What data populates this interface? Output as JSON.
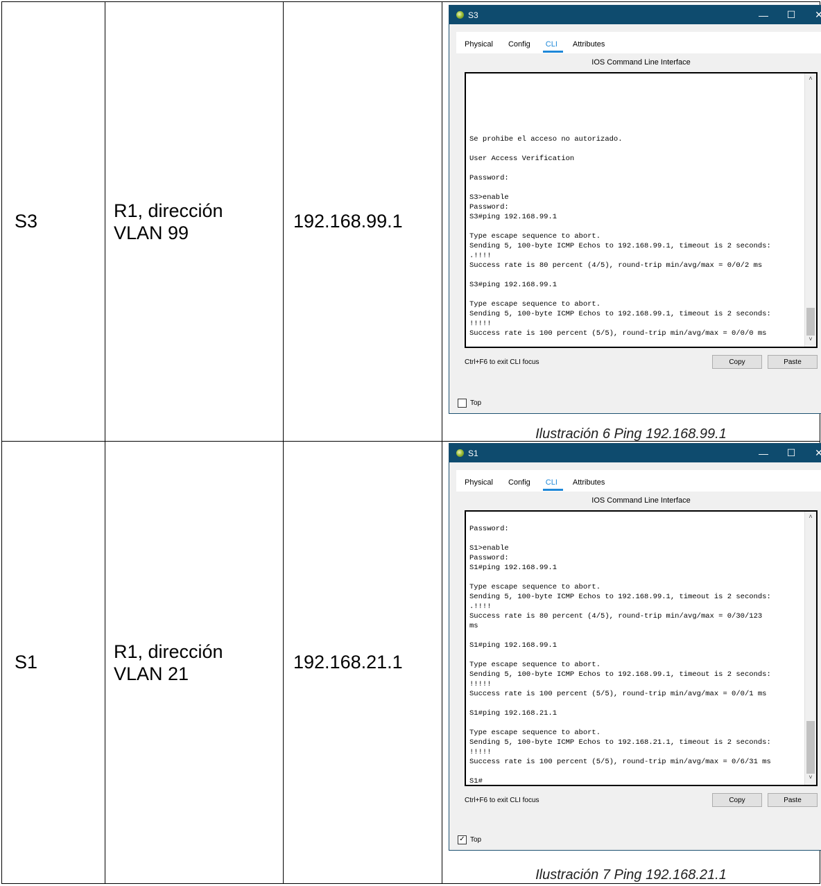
{
  "rows": [
    {
      "device": "S3",
      "description_line1": "R1, dirección",
      "description_line2": "VLAN 99",
      "ip": "192.168.99.1",
      "window": {
        "title": "S3",
        "tabs": [
          "Physical",
          "Config",
          "CLI",
          "Attributes"
        ],
        "active_tab": "CLI",
        "cli_header": "IOS Command Line Interface",
        "terminal_text": "\n\n\n\n\n\nSe prohibe el acceso no autorizado.\n\nUser Access Verification\n\nPassword:\n\nS3>enable\nPassword:\nS3#ping 192.168.99.1\n\nType escape sequence to abort.\nSending 5, 100-byte ICMP Echos to 192.168.99.1, timeout is 2 seconds:\n.!!!!\nSuccess rate is 80 percent (4/5), round-trip min/avg/max = 0/0/2 ms\n\nS3#ping 192.168.99.1\n\nType escape sequence to abort.\nSending 5, 100-byte ICMP Echos to 192.168.99.1, timeout is 2 seconds:\n!!!!!\nSuccess rate is 100 percent (5/5), round-trip min/avg/max = 0/0/0 ms\n\nS3#|",
        "focus_hint": "Ctrl+F6 to exit CLI focus",
        "copy_label": "Copy",
        "paste_label": "Paste",
        "top_label": "Top",
        "top_checked": false
      },
      "caption": "Ilustración 6 Ping 192.168.99.1"
    },
    {
      "device": "S1",
      "description_line1": "R1, dirección",
      "description_line2": "VLAN 21",
      "ip": "192.168.21.1",
      "window": {
        "title": "S1",
        "tabs": [
          "Physical",
          "Config",
          "CLI",
          "Attributes"
        ],
        "active_tab": "CLI",
        "cli_header": "IOS Command Line Interface",
        "terminal_text": "\nPassword:\n\nS1>enable\nPassword:\nS1#ping 192.168.99.1\n\nType escape sequence to abort.\nSending 5, 100-byte ICMP Echos to 192.168.99.1, timeout is 2 seconds:\n.!!!!\nSuccess rate is 80 percent (4/5), round-trip min/avg/max = 0/30/123\nms\n\nS1#ping 192.168.99.1\n\nType escape sequence to abort.\nSending 5, 100-byte ICMP Echos to 192.168.99.1, timeout is 2 seconds:\n!!!!!\nSuccess rate is 100 percent (5/5), round-trip min/avg/max = 0/0/1 ms\n\nS1#ping 192.168.21.1\n\nType escape sequence to abort.\nSending 5, 100-byte ICMP Echos to 192.168.21.1, timeout is 2 seconds:\n!!!!!\nSuccess rate is 100 percent (5/5), round-trip min/avg/max = 0/6/31 ms\n\nS1#",
        "focus_hint": "Ctrl+F6 to exit CLI focus",
        "copy_label": "Copy",
        "paste_label": "Paste",
        "top_label": "Top",
        "top_checked": true
      },
      "caption": "Ilustración 7 Ping 192.168.21.1"
    }
  ],
  "icons": {
    "minimize": "—",
    "maximize": "☐",
    "close": "✕",
    "scroll_up": "˄",
    "scroll_down": "˅",
    "check": "✓"
  },
  "colors": {
    "titlebar": "#0e4b6e",
    "active_tab": "#1e88d8"
  }
}
